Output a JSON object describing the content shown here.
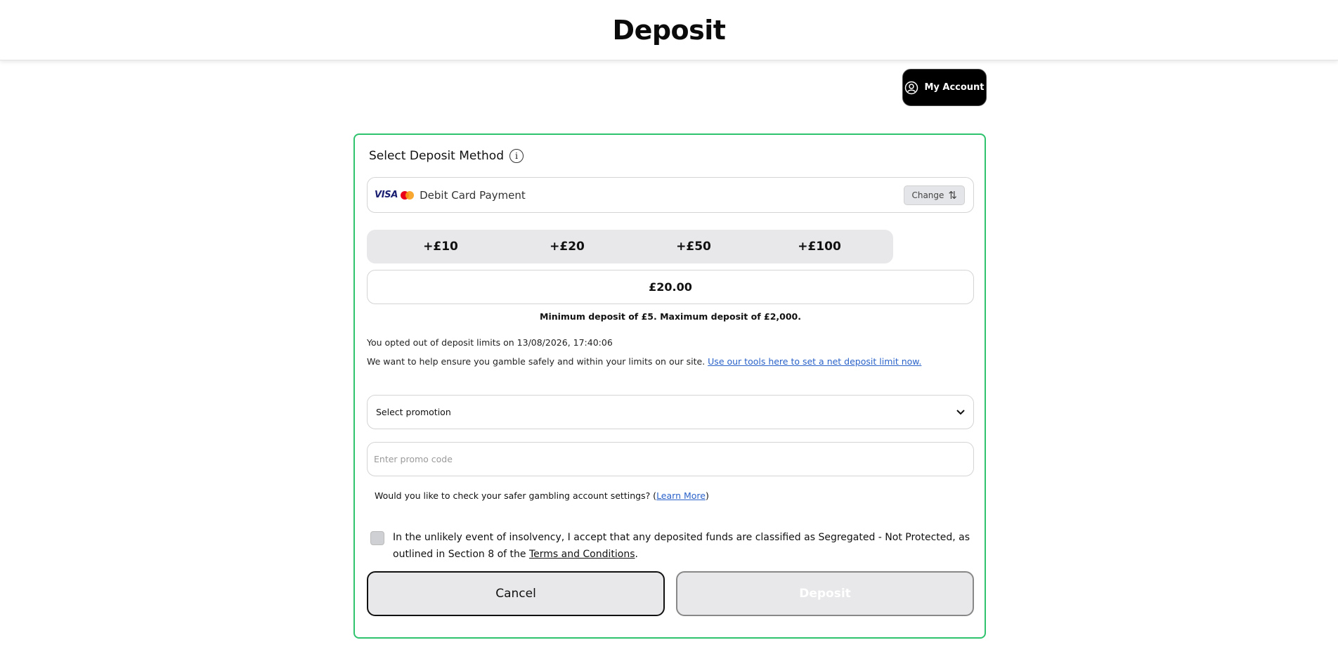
{
  "header": {
    "title": "Deposit"
  },
  "account": {
    "label": "My Account",
    "icon": "user-circle-icon"
  },
  "deposit_method": {
    "title": "Select Deposit Method",
    "info_icon": "info-icon",
    "brand_visa": "VISA",
    "method_label": "Debit Card Payment",
    "change_label": "Change",
    "change_icon": "swap-vertical-icon"
  },
  "quick_amounts": [
    "+£10",
    "+£20",
    "+£50",
    "+£100"
  ],
  "amount": {
    "value": "£20.00"
  },
  "limits_text": "Minimum deposit of £5. Maximum deposit of £2,000.",
  "optout_text": "You opted out of deposit limits on 13/08/2026, 17:40:06",
  "safety": {
    "text": "We want to help ensure you gamble safely and within your limits on our site.",
    "link": "Use our tools here to set a net deposit limit now."
  },
  "promotion": {
    "selected": "Select promotion"
  },
  "promo_code": {
    "placeholder": "Enter promo code"
  },
  "gambling_check": {
    "text": "Would you like to check your safer gambling account settings? (",
    "link": "Learn More",
    "close": ")"
  },
  "consent": {
    "checked": false,
    "text": "In the unlikely event of insolvency, I accept that any deposited funds are classified as Segregated - Not Protected, as outlined in Section 8 of the ",
    "terms": "Terms and Conditions",
    "end": "."
  },
  "actions": {
    "cancel": "Cancel",
    "deposit": "Deposit"
  },
  "colors": {
    "accent_border": "#2fc36e",
    "link": "#2a62c9",
    "button_bg": "#e8e8ea"
  }
}
